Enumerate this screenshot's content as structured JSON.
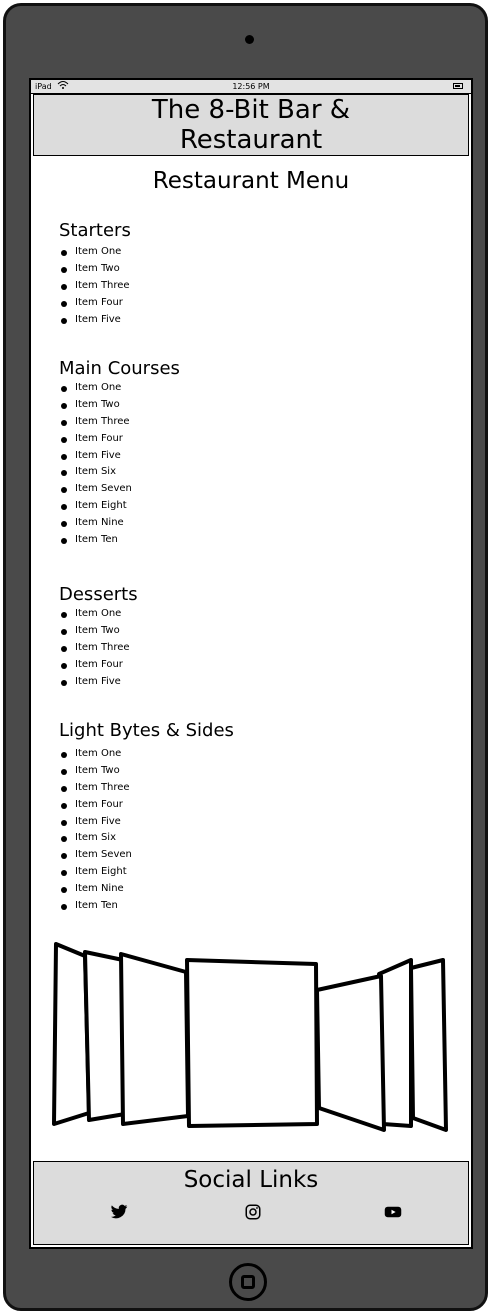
{
  "status_bar": {
    "carrier": "iPad",
    "time": "12:56 PM"
  },
  "header": {
    "title_line1": "The 8-Bit Bar &",
    "title_line2": "Restaurant"
  },
  "page_title": "Restaurant Menu",
  "sections": [
    {
      "title": "Starters",
      "items": [
        "Item One",
        "Item Two",
        "Item Three",
        "Item Four",
        "Item Five"
      ]
    },
    {
      "title": "Main Courses",
      "items": [
        "Item One",
        "Item Two",
        "Item Three",
        "Item Four",
        "Item Five",
        "Item Six",
        "Item Seven",
        "Item Eight",
        "Item Nine",
        "Item Ten"
      ]
    },
    {
      "title": "Desserts",
      "items": [
        "Item One",
        "Item Two",
        "Item Three",
        "Item Four",
        "Item Five"
      ]
    },
    {
      "title": "Light Bytes & Sides",
      "items": [
        "Item One",
        "Item Two",
        "Item Three",
        "Item Four",
        "Item Five",
        "Item Six",
        "Item Seven",
        "Item Eight",
        "Item Nine",
        "Item Ten"
      ]
    }
  ],
  "footer": {
    "title": "Social Links",
    "icons": [
      "twitter-icon",
      "instagram-icon",
      "youtube-icon"
    ]
  }
}
